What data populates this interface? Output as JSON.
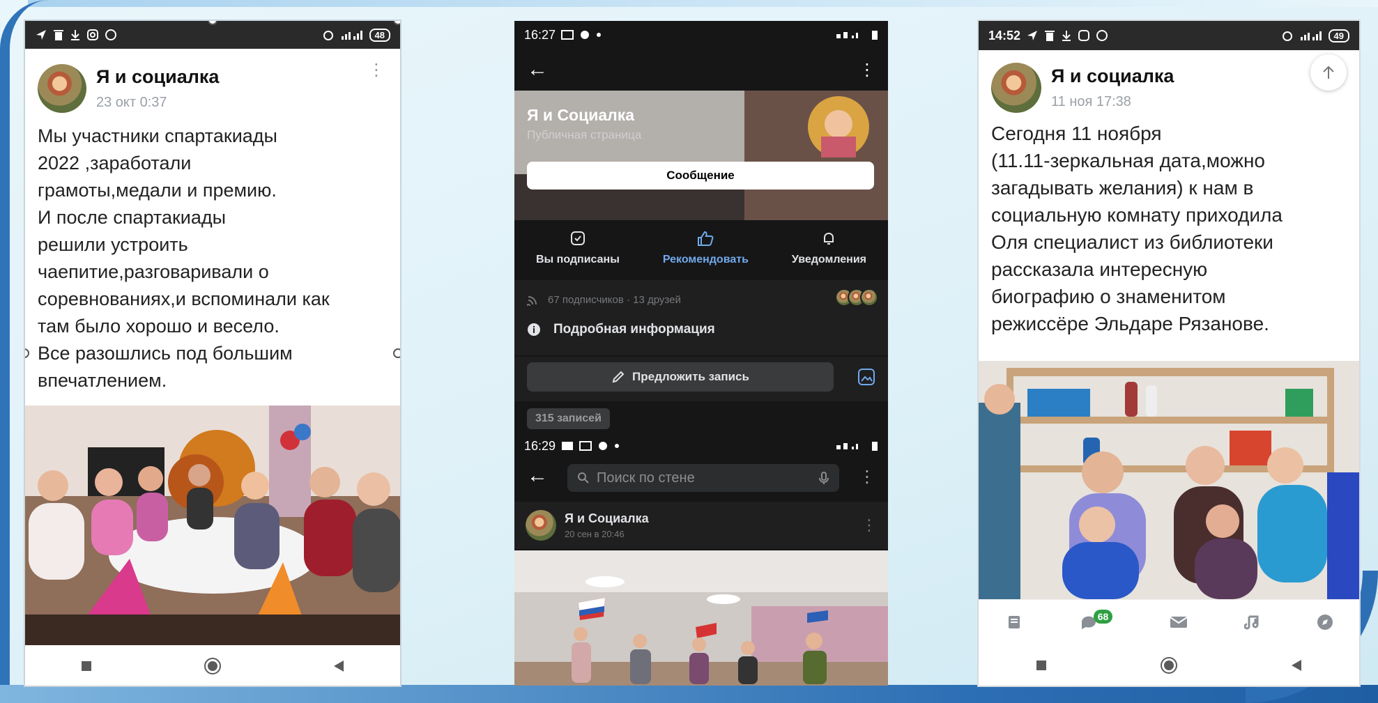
{
  "colors": {
    "vk_blue": "#71aaeb",
    "frame_blue": "#2d6fb4",
    "dark_bg": "#161617",
    "badge_green": "#2ea043"
  },
  "phone1": {
    "status": {
      "battery": "48"
    },
    "post": {
      "author": "Я и социалка",
      "date": "23 окт 0:37",
      "text_lines": [
        "Мы  участники спартакиады",
        "2022 ,заработали",
        "грамоты,медали и премию.",
        "И после спартакиады",
        "решили устроить",
        "чаепитие,разговаривали о",
        "соревнованиях,и вспоминали как",
        "там было хорошо и весело.",
        "Все разошлись под большим",
        "впечатлением."
      ]
    },
    "icons": [
      "more-vertical-icon",
      "stop-icon",
      "home-icon",
      "back-icon"
    ]
  },
  "phone2": {
    "status": {
      "time": "16:27"
    },
    "page": {
      "title": "Я и Социалка",
      "subtitle": "Публичная страница",
      "message_button": "Сообщение"
    },
    "actions": [
      {
        "label": "Вы подписаны",
        "icon": "subscribed-icon"
      },
      {
        "label": "Рекомендовать",
        "icon": "thumbs-up-icon"
      },
      {
        "label": "Уведомления",
        "icon": "bell-icon"
      }
    ],
    "subscribers": "67 подписчиков · 13 друзей",
    "info_label": "Подробная информация",
    "suggest_label": "Предложить запись",
    "posts_count": "315 записей",
    "status2": {
      "time": "16:29"
    },
    "search": {
      "placeholder": "Поиск по стене"
    },
    "mini_post": {
      "author": "Я и Социалка",
      "date": "20 сен в 20:46"
    }
  },
  "phone3": {
    "status": {
      "time": "14:52",
      "battery": "49"
    },
    "post": {
      "author": "Я и социалка",
      "date": "11 ноя 17:38",
      "text_lines": [
        "Сегодня 11 ноября",
        "(11.11-зеркальная дата,можно",
        "загадывать желания) к нам в",
        "социальную комнату приходила",
        "Оля специалист из библиотеки",
        "рассказала интересную",
        "биографию о знаменитом",
        "режиссёре Эльдаре Рязанове."
      ]
    },
    "tabbar": {
      "chat_badge": "68"
    }
  }
}
